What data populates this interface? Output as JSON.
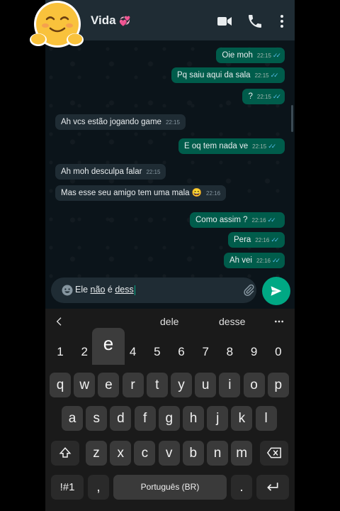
{
  "header": {
    "contact_name": "Vida",
    "name_emoji": "💞",
    "icons": [
      "video-call-icon",
      "phone-call-icon",
      "more-options-icon"
    ]
  },
  "messages": [
    {
      "dir": "out",
      "text": "Oie moh",
      "time": "22:15",
      "status": "read"
    },
    {
      "dir": "out",
      "text": "Pq saiu aqui da sala",
      "time": "22:15",
      "status": "read"
    },
    {
      "dir": "out",
      "text": "?",
      "time": "22:15",
      "status": "read"
    },
    {
      "dir": "in",
      "text": "Ah vcs estão jogando game",
      "time": "22:15"
    },
    {
      "dir": "out",
      "text": "E oq tem nada ve",
      "time": "22:15",
      "status": "read"
    },
    {
      "dir": "in",
      "text": "Ah moh desculpa falar",
      "time": "22:15"
    },
    {
      "dir": "in",
      "text": "Mas esse seu amigo tem uma mala 😄",
      "time": "22:16"
    },
    {
      "dir": "out",
      "text": "Como assim ?",
      "time": "22:16",
      "status": "read"
    },
    {
      "dir": "out",
      "text": "Pera",
      "time": "22:16",
      "status": "read"
    },
    {
      "dir": "out",
      "text": "Ah vei",
      "time": "22:16",
      "status": "read"
    }
  ],
  "composer": {
    "text_before": "Ele ",
    "text_underlined_1": "não",
    "text_middle": " é ",
    "text_underlined_2": "dess"
  },
  "keyboard": {
    "suggestions": [
      "dele",
      "desse"
    ],
    "number_row": [
      "1",
      "2",
      "3",
      "4",
      "5",
      "6",
      "7",
      "8",
      "9",
      "0"
    ],
    "row1": [
      "q",
      "w",
      "e",
      "r",
      "t",
      "y",
      "u",
      "i",
      "o",
      "p"
    ],
    "row2": [
      "a",
      "s",
      "d",
      "f",
      "g",
      "h",
      "j",
      "k",
      "l"
    ],
    "row3": [
      "z",
      "x",
      "c",
      "v",
      "b",
      "n",
      "m"
    ],
    "symbols_label": "!#1",
    "comma_label": ",",
    "space_label": "Português (BR)",
    "period_label": ".",
    "popup_key": "e"
  },
  "colors": {
    "outgoing_bubble": "#005c4b",
    "incoming_bubble": "#1f2c34",
    "accent": "#00a884",
    "read_ticks": "#53bdeb"
  }
}
